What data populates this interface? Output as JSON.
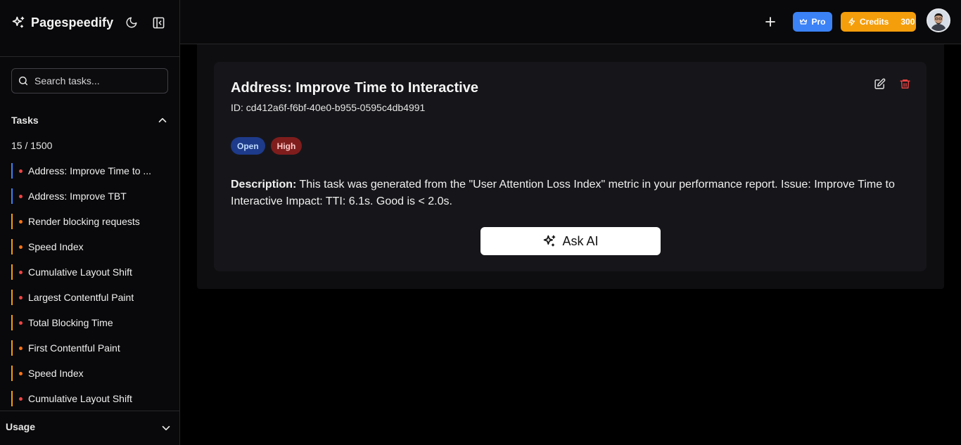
{
  "brand": {
    "name": "Pagespeedify"
  },
  "search": {
    "placeholder": "Search tasks..."
  },
  "tasks": {
    "title": "Tasks",
    "count": "15 / 1500",
    "items": [
      {
        "label": "Address: Improve Time to ...",
        "bar": "#3b82f6",
        "dot": "#ef4444"
      },
      {
        "label": "Address: Improve TBT",
        "bar": "#3b82f6",
        "dot": "#ef4444"
      },
      {
        "label": "Render blocking requests",
        "bar": "#f59e0b",
        "dot": "#f97316"
      },
      {
        "label": "Speed Index",
        "bar": "#f59e0b",
        "dot": "#f97316"
      },
      {
        "label": "Cumulative Layout Shift",
        "bar": "#f59e0b",
        "dot": "#ef4444"
      },
      {
        "label": "Largest Contentful Paint",
        "bar": "#f59e0b",
        "dot": "#ef4444"
      },
      {
        "label": "Total Blocking Time",
        "bar": "#f59e0b",
        "dot": "#ef4444"
      },
      {
        "label": "First Contentful Paint",
        "bar": "#f59e0b",
        "dot": "#f97316"
      },
      {
        "label": "Speed Index",
        "bar": "#f59e0b",
        "dot": "#f97316"
      },
      {
        "label": "Cumulative Layout Shift",
        "bar": "#f59e0b",
        "dot": "#ef4444"
      }
    ]
  },
  "usage": {
    "title": "Usage"
  },
  "topbar": {
    "pro_label": "Pro",
    "credits_label": "Credits",
    "credits_value": "300"
  },
  "task_detail": {
    "title": "Address: Improve Time to Interactive",
    "id_text": "ID: cd412a6f-f6bf-40e0-b955-0595c4db4991",
    "status": "Open",
    "priority": "High",
    "description_label": "Description:",
    "description_text": " This task was generated from the \"User Attention Loss Index\" metric in your performance report. Issue: Improve Time to Interactive Impact: TTI: 6.1s. Good is < 2.0s.",
    "ask_ai_label": "Ask AI"
  },
  "colors": {
    "accent_blue": "#3b82f6",
    "accent_amber": "#f59e0b",
    "danger": "#ef4444"
  }
}
